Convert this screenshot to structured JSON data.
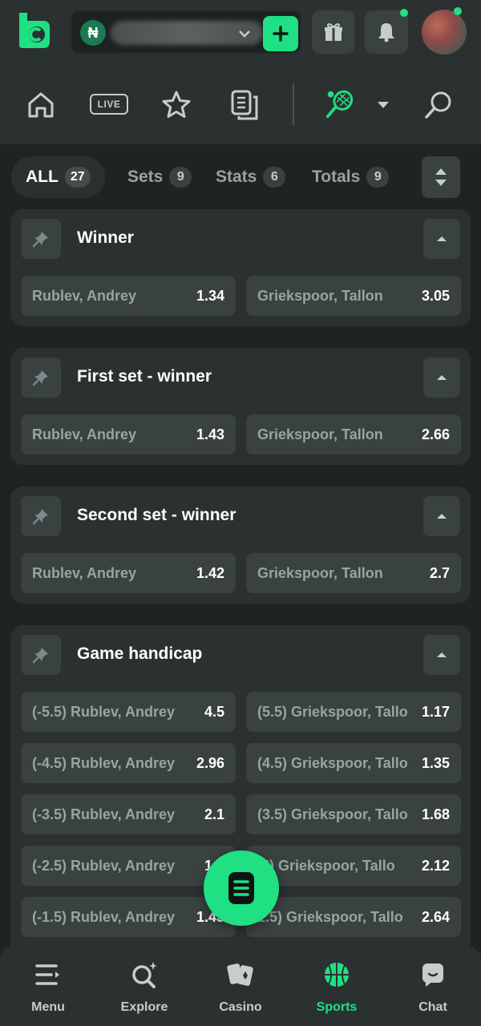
{
  "header": {
    "currency_symbol": "₦",
    "icons": [
      "logo-icon",
      "chevron-down-icon",
      "plus-icon",
      "gift-icon",
      "bell-icon",
      "avatar"
    ]
  },
  "sport_nav": {
    "live_label": "LIVE",
    "icons": [
      "home-icon",
      "live-icon",
      "star-icon",
      "betslips-icon",
      "tennis-icon",
      "caret-down-icon",
      "search-icon"
    ]
  },
  "filters": [
    {
      "label": "ALL",
      "count": "27",
      "active": true
    },
    {
      "label": "Sets",
      "count": "9"
    },
    {
      "label": "Stats",
      "count": "6"
    },
    {
      "label": "Totals",
      "count": "9"
    }
  ],
  "markets": [
    {
      "title": "Winner",
      "rows": [
        [
          {
            "label": "Rublev, Andrey",
            "odd": "1.34"
          },
          {
            "label": "Griekspoor, Tallon",
            "odd": "3.05"
          }
        ]
      ]
    },
    {
      "title": "First set - winner",
      "rows": [
        [
          {
            "label": "Rublev, Andrey",
            "odd": "1.43"
          },
          {
            "label": "Griekspoor, Tallon",
            "odd": "2.66"
          }
        ]
      ]
    },
    {
      "title": "Second set - winner",
      "rows": [
        [
          {
            "label": "Rublev, Andrey",
            "odd": "1.42"
          },
          {
            "label": "Griekspoor, Tallon",
            "odd": "2.7"
          }
        ]
      ]
    },
    {
      "title": "Game handicap",
      "rows": [
        [
          {
            "label": "(-5.5) Rublev, Andrey",
            "odd": "4.5"
          },
          {
            "label": "(5.5) Griekspoor, Tallo",
            "odd": "1.17"
          }
        ],
        [
          {
            "label": "(-4.5) Rublev, Andrey",
            "odd": "2.96"
          },
          {
            "label": "(4.5) Griekspoor, Tallo",
            "odd": "1.35"
          }
        ],
        [
          {
            "label": "(-3.5) Rublev, Andrey",
            "odd": "2.1"
          },
          {
            "label": "(3.5) Griekspoor, Tallo",
            "odd": "1.68"
          }
        ],
        [
          {
            "label": "(-2.5) Rublev, Andrey",
            "odd": "1.6"
          },
          {
            "label": ".5) Griekspoor, Tallo",
            "odd": "2.12"
          }
        ],
        [
          {
            "label": "(-1.5) Rublev, Andrey",
            "odd": "1.43"
          },
          {
            "label": "1.5) Griekspoor, Tallo",
            "odd": "2.64"
          }
        ]
      ]
    }
  ],
  "bottom_nav": [
    {
      "label": "Menu",
      "icon": "menu-icon"
    },
    {
      "label": "Explore",
      "icon": "explore-icon"
    },
    {
      "label": "Casino",
      "icon": "casino-icon"
    },
    {
      "label": "Sports",
      "icon": "sports-icon",
      "active": true
    },
    {
      "label": "Chat",
      "icon": "chat-icon"
    }
  ],
  "colors": {
    "accent": "#1fe082",
    "panel": "#2b3131",
    "button": "#3a4141",
    "background": "#1f2323"
  }
}
